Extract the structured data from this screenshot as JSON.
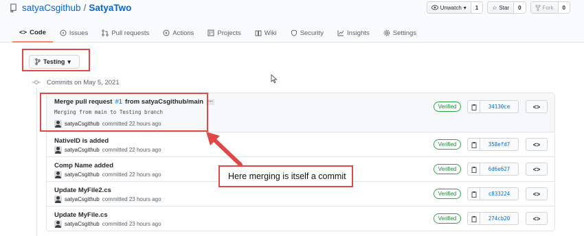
{
  "header": {
    "owner": "satyaCsgithub",
    "separator": "/",
    "repo": "SatyaTwo",
    "actions": [
      {
        "label": "Unwatch",
        "count": "1",
        "icon": "eye-icon"
      },
      {
        "label": "Star",
        "count": "0",
        "icon": "star-icon"
      },
      {
        "label": "Fork",
        "count": "0",
        "icon": "fork-icon"
      }
    ]
  },
  "tabs": [
    {
      "label": "Code",
      "icon": "code-icon",
      "active": true
    },
    {
      "label": "Issues",
      "icon": "issue-icon"
    },
    {
      "label": "Pull requests",
      "icon": "pull-request-icon"
    },
    {
      "label": "Actions",
      "icon": "play-icon"
    },
    {
      "label": "Projects",
      "icon": "project-icon"
    },
    {
      "label": "Wiki",
      "icon": "book-icon"
    },
    {
      "label": "Security",
      "icon": "shield-icon"
    },
    {
      "label": "Insights",
      "icon": "graph-icon"
    },
    {
      "label": "Settings",
      "icon": "gear-icon"
    }
  ],
  "branch": {
    "name": "Testing"
  },
  "commits_header": "Commits on May 5, 2021",
  "commits": [
    {
      "title_prefix": "Merge pull request ",
      "pr_link": "#1",
      "title_suffix": " from satyaCsgithub/main",
      "ellipsis": "…",
      "description": "Merging from main to Testing branch",
      "author": "satyaCsgithub",
      "time": "committed 22 hours ago",
      "verified": "Verified",
      "sha": "34130ce"
    },
    {
      "title": "NativeID is added",
      "author": "satyaCsgithub",
      "time": "committed 22 hours ago",
      "verified": "Verified",
      "sha": "358efd7"
    },
    {
      "title": "Comp Name added",
      "author": "satyaCsgithub",
      "time": "committed 22 hours ago",
      "verified": "Verified",
      "sha": "6d6e627"
    },
    {
      "title": "Update MyFile2.cs",
      "author": "satyaCsgithub",
      "time": "committed 23 hours ago",
      "verified": "Verified",
      "sha": "c833224"
    },
    {
      "title": "Update MyFile.cs",
      "author": "satyaCsgithub",
      "time": "committed 23 hours ago",
      "verified": "Verified",
      "sha": "274cb20"
    }
  ],
  "annotation": {
    "note": "Here merging is itself a commit"
  },
  "colors": {
    "accent": "#0366d6",
    "highlight": "#e04848",
    "verified": "#28a745",
    "tab_underline": "#f9826c"
  }
}
